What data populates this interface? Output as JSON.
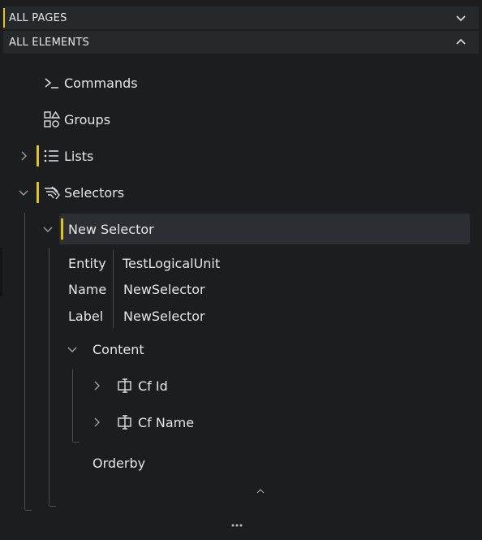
{
  "sections": {
    "all_pages": "ALL PAGES",
    "all_elements": "ALL ELEMENTS"
  },
  "tree": {
    "commands": "Commands",
    "groups": "Groups",
    "lists": "Lists",
    "selectors": "Selectors",
    "new_selector": "New Selector",
    "properties": [
      {
        "key": "Entity",
        "value": "TestLogicalUnit"
      },
      {
        "key": "Name",
        "value": "NewSelector"
      },
      {
        "key": "Label",
        "value": "NewSelector"
      }
    ],
    "content": "Content",
    "content_items": [
      "Cf Id",
      "Cf Name"
    ],
    "orderby": "Orderby"
  },
  "icons": {
    "commands": "terminal-icon",
    "groups": "shapes-icon",
    "lists": "list-icon",
    "selectors": "selector-icon",
    "field": "field-icon",
    "more": "ellipsis-icon"
  },
  "colors": {
    "accent": "#e3c41a",
    "background": "#1b1d1f",
    "header": "#26292c",
    "selected": "#2b2e32"
  }
}
